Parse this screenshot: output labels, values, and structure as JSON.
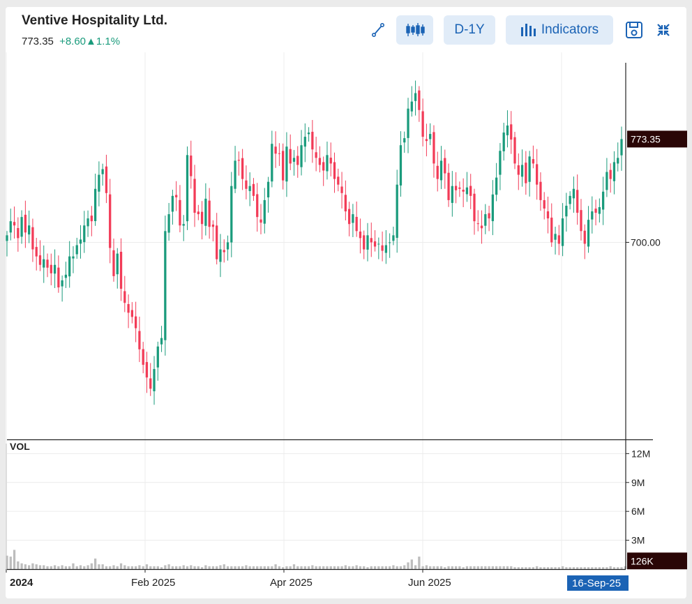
{
  "header": {
    "company": "Ventive Hospitality Ltd.",
    "last_price": "773.35",
    "change": "+8.60",
    "change_pct": "1.1%",
    "up_arrow": "▲"
  },
  "toolbar": {
    "draw_icon": "line-draw-icon",
    "candle_icon": "candlestick-icon",
    "range_label": "D-1Y",
    "indicators_label": "Indicators",
    "save_icon": "floppy-save-icon",
    "collapse_icon": "collapse-arrows-icon"
  },
  "colors": {
    "up": "#1a9b7c",
    "down": "#f23b57",
    "accent": "#1b63b5",
    "button_bg": "#e1ecf8",
    "price_tag_bg": "#2a0606",
    "date_tag_bg": "#1b63b5",
    "volume_bar": "#bdbdbd"
  },
  "chart_data": {
    "type": "candlestick",
    "y_axis": {
      "ticks": [
        "700.00"
      ],
      "min": 560,
      "max": 835
    },
    "last_price_label": "773.35",
    "x_axis": {
      "labels": [
        "2024",
        "Feb 2025",
        "Apr 2025",
        "Jun 2025"
      ],
      "cursor_label": "16-Sep-25"
    },
    "volume": {
      "label": "VOL",
      "ticks": [
        "12M",
        "9M",
        "6M",
        "3M"
      ],
      "tick_values": [
        12000000,
        9000000,
        6000000,
        3000000
      ],
      "last_label": "126K",
      "last_value": 126000
    },
    "closes": [
      705,
      715,
      712,
      703,
      718,
      707,
      712,
      695,
      690,
      684,
      688,
      682,
      678,
      684,
      668,
      673,
      677,
      690,
      690,
      698,
      702,
      712,
      717,
      715,
      738,
      748,
      752,
      735,
      696,
      676,
      692,
      667,
      657,
      650,
      647,
      639,
      624,
      613,
      604,
      596,
      610,
      626,
      632,
      708,
      720,
      733,
      732,
      712,
      713,
      762,
      747,
      721,
      720,
      713,
      731,
      711,
      711,
      688,
      695,
      693,
      700,
      740,
      758,
      758,
      745,
      738,
      740,
      733,
      718,
      714,
      730,
      743,
      770,
      763,
      763,
      744,
      768,
      756,
      760,
      755,
      769,
      775,
      778,
      766,
      760,
      755,
      751,
      762,
      756,
      745,
      741,
      735,
      722,
      713,
      720,
      708,
      703,
      695,
      705,
      700,
      697,
      699,
      694,
      698,
      700,
      705,
      741,
      769,
      774,
      795,
      800,
      806,
      794,
      775,
      772,
      777,
      756,
      745,
      758,
      749,
      730,
      740,
      737,
      738,
      736,
      739,
      733,
      715,
      713,
      710,
      720,
      717,
      734,
      746,
      765,
      778,
      783,
      773,
      756,
      748,
      755,
      742,
      761,
      756,
      741,
      730,
      724,
      717,
      700,
      706,
      699,
      717,
      726,
      733,
      738,
      721,
      708,
      699,
      716,
      722,
      721,
      725,
      736,
      750,
      745,
      757,
      760,
      773.35
    ],
    "volumes_millions": [
      1.4,
      1.3,
      2.0,
      0.8,
      0.6,
      0.5,
      0.4,
      0.6,
      0.5,
      0.4,
      0.4,
      0.3,
      0.3,
      0.4,
      0.3,
      0.4,
      0.3,
      0.3,
      0.6,
      0.3,
      0.4,
      0.3,
      0.4,
      0.6,
      1.1,
      0.5,
      0.5,
      0.3,
      0.3,
      0.4,
      0.3,
      0.6,
      0.4,
      0.3,
      0.3,
      0.3,
      0.4,
      0.3,
      0.5,
      0.3,
      0.3,
      0.3,
      0.2,
      0.4,
      0.5,
      0.3,
      0.3,
      0.3,
      0.4,
      0.3,
      0.4,
      0.3,
      0.3,
      0.2,
      0.4,
      0.3,
      0.3,
      0.3,
      0.4,
      0.5,
      0.3,
      0.3,
      0.3,
      0.3,
      0.3,
      0.4,
      0.3,
      0.3,
      0.3,
      0.3,
      0.3,
      0.3,
      0.3,
      0.5,
      0.3,
      0.2,
      0.3,
      0.3,
      0.5,
      0.3,
      0.3,
      0.3,
      0.3,
      0.4,
      0.3,
      0.3,
      0.3,
      0.3,
      0.3,
      0.3,
      0.3,
      0.3,
      0.4,
      0.3,
      0.3,
      0.4,
      0.3,
      0.3,
      0.2,
      0.3,
      0.3,
      0.3,
      0.3,
      0.3,
      0.3,
      0.4,
      0.3,
      0.3,
      0.4,
      0.7,
      1.0,
      0.4,
      1.3,
      0.3,
      0.4,
      0.3,
      0.3,
      0.3,
      0.3,
      0.2,
      0.3,
      0.3,
      0.3,
      0.3,
      0.2,
      0.3,
      0.3,
      0.3,
      0.3,
      0.3,
      0.3,
      0.3,
      0.3,
      0.3,
      0.3,
      0.3,
      0.3,
      0.3,
      0.2,
      0.2,
      0.2,
      0.2,
      0.2,
      0.2,
      0.3,
      0.2,
      0.2,
      0.2,
      0.2,
      0.2,
      0.2,
      0.3,
      0.2,
      0.2,
      0.2,
      0.2,
      0.2,
      0.2,
      0.2,
      0.2,
      0.2,
      0.2,
      0.2,
      0.2,
      0.3,
      0.2,
      0.2,
      0.2,
      0.3,
      0.126
    ],
    "grid": true
  }
}
